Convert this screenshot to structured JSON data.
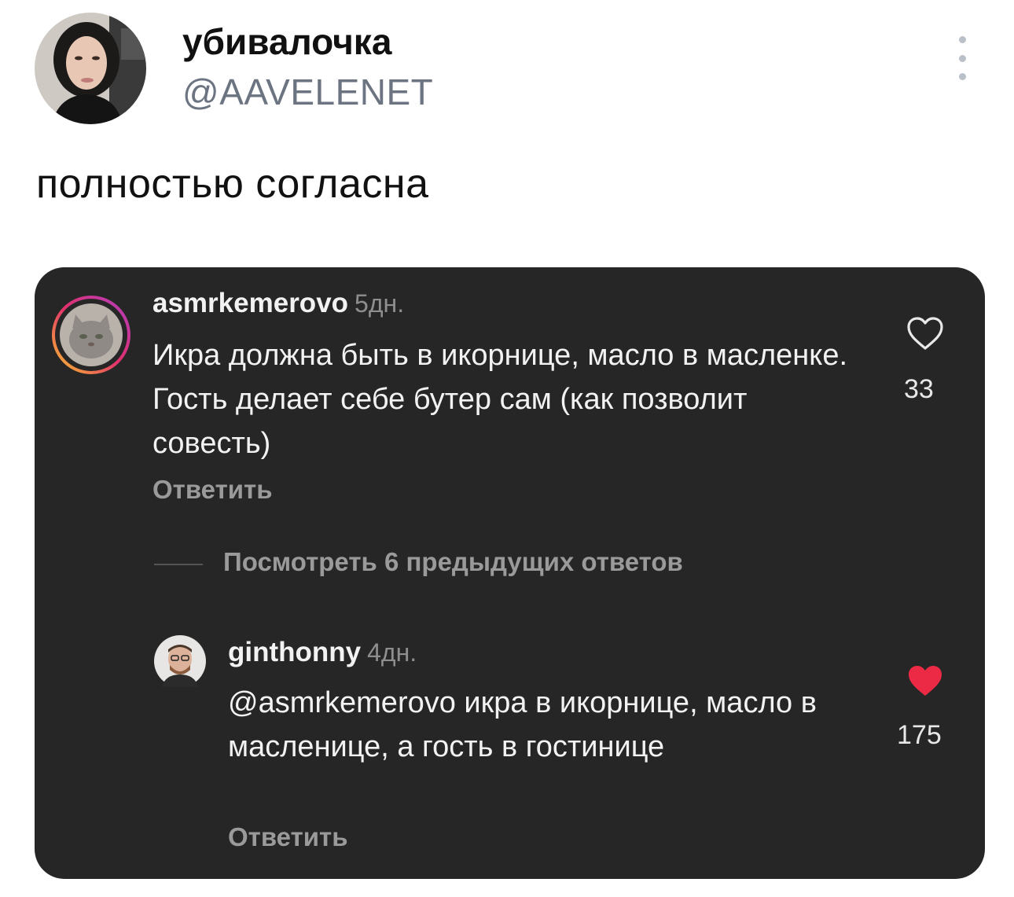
{
  "tweet": {
    "display_name": "убивалочка",
    "handle": "@AAVELENET",
    "text": "полностью согласна",
    "more_icon": "more-vertical-icon"
  },
  "comments": [
    {
      "username": "asmrkemerovo",
      "time": "5дн.",
      "text": "Икра должна быть в икорнице, масло в масленке. Гость делает себе бутер сам (как позволит совесть)",
      "likes": "33",
      "reply_label": "Ответить",
      "liked": false
    },
    {
      "username": "ginthonny",
      "time": "4дн.",
      "text": "@asmrkemerovo икра в икорнице, масло в масленице, а гость в гостинице",
      "likes": "175",
      "reply_label": "Ответить",
      "liked": true
    }
  ],
  "view_previous": "Посмотреть 6 предыдущих ответов",
  "colors": {
    "card_bg": "#262626",
    "muted_text": "#9a9a9a",
    "like_red": "#ed2a45",
    "handle_gray": "#6b7480"
  }
}
